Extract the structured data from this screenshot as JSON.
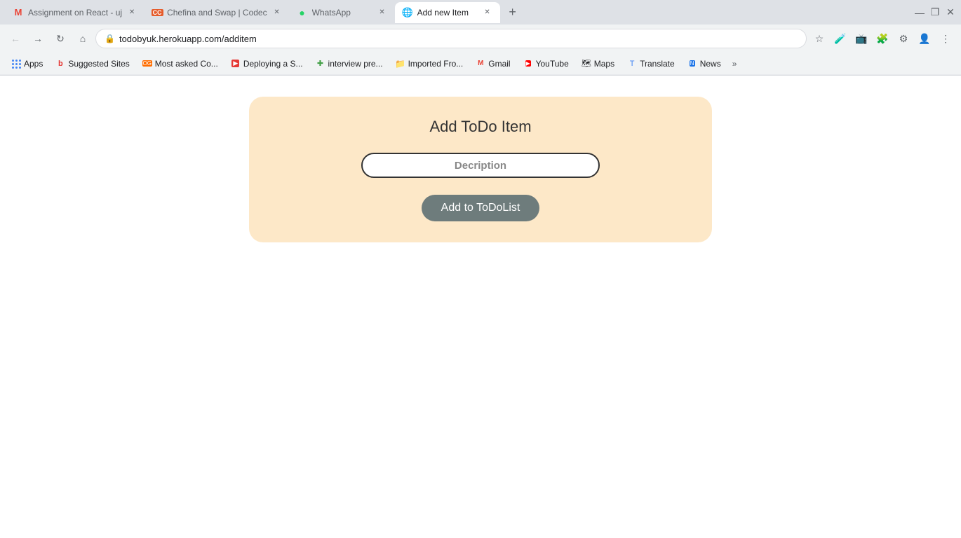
{
  "browser": {
    "tabs": [
      {
        "id": "tab1",
        "title": "Assignment on React - uj",
        "favicon_type": "gmail",
        "active": false,
        "closeable": true
      },
      {
        "id": "tab2",
        "title": "Chefina and Swap | Codec",
        "favicon_type": "cc",
        "active": false,
        "closeable": true
      },
      {
        "id": "tab3",
        "title": "WhatsApp",
        "favicon_type": "whatsapp",
        "active": false,
        "closeable": true
      },
      {
        "id": "tab4",
        "title": "Add new Item",
        "favicon_type": "globe",
        "active": true,
        "closeable": true
      }
    ],
    "address": "todobyuk.herokuapp.com/additem",
    "window_controls": {
      "minimize": "—",
      "maximize": "❐",
      "close": "✕"
    }
  },
  "bookmarks": [
    {
      "id": "bk-apps",
      "label": "Apps",
      "favicon_type": "apps"
    },
    {
      "id": "bk-suggested",
      "label": "Suggested Sites",
      "favicon_type": "red-b"
    },
    {
      "id": "bk-mostasked",
      "label": "Most asked Co...",
      "favicon_type": "orange-og"
    },
    {
      "id": "bk-deploying",
      "label": "Deploying a S...",
      "favicon_type": "red-square"
    },
    {
      "id": "bk-interview",
      "label": "interview pre...",
      "favicon_type": "green-plus"
    },
    {
      "id": "bk-imported",
      "label": "Imported Fro...",
      "favicon_type": "folder"
    },
    {
      "id": "bk-gmail",
      "label": "Gmail",
      "favicon_type": "gmail"
    },
    {
      "id": "bk-youtube",
      "label": "YouTube",
      "favicon_type": "youtube"
    },
    {
      "id": "bk-maps",
      "label": "Maps",
      "favicon_type": "maps"
    },
    {
      "id": "bk-translate",
      "label": "Translate",
      "favicon_type": "translate"
    },
    {
      "id": "bk-news",
      "label": "News",
      "favicon_type": "news"
    }
  ],
  "page": {
    "title": "Add ToDo Item",
    "input_placeholder": "Decription",
    "button_label": "Add to ToDoList",
    "card_bg": "#fde8c8"
  }
}
